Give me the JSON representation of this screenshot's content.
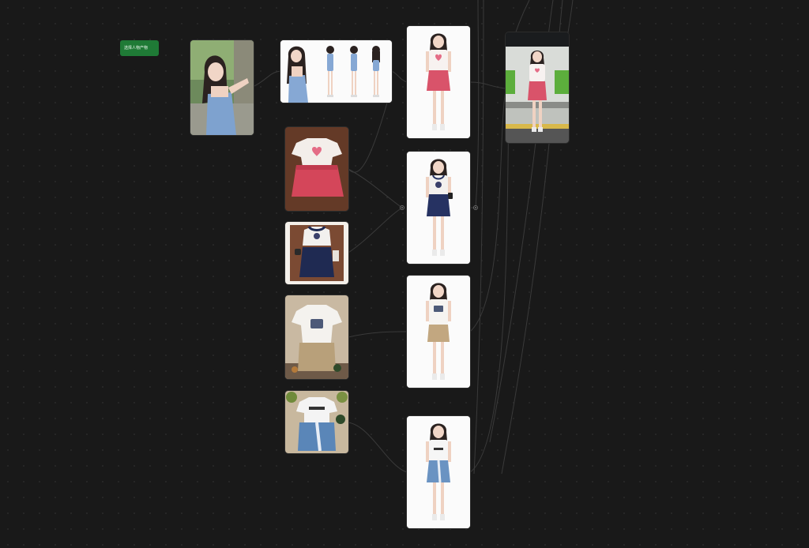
{
  "canvas": {
    "background": "#191919",
    "start_node_label": "选择人物产物",
    "start_node_color": "#1f7a36",
    "nodes": [
      {
        "id": "reference-photo",
        "kind": "image",
        "content": "girl-in-blue-tank-dress-outdoor"
      },
      {
        "id": "pose-sheet",
        "kind": "image",
        "content": "four-pose-reference-sheet"
      },
      {
        "id": "garment-1",
        "kind": "image",
        "content": "white-heart-tee-pink-skirt",
        "top_color": "#f3eeea",
        "bottom_color": "#d4465a"
      },
      {
        "id": "garment-2",
        "kind": "image",
        "content": "white-navy-trim-tee-navy-skirt",
        "top_color": "#f2f0ee",
        "bottom_color": "#1f2a52"
      },
      {
        "id": "garment-3",
        "kind": "image",
        "content": "white-print-tee-khaki-skirt",
        "top_color": "#f4f2ee",
        "bottom_color": "#b8a07a"
      },
      {
        "id": "garment-4",
        "kind": "image",
        "content": "white-tee-denim-skirt",
        "top_color": "#f4f4f4",
        "bottom_color": "#5a86b8"
      },
      {
        "id": "model-1",
        "kind": "image",
        "content": "model-pink-skirt",
        "top_color": "#f7f2f0",
        "bottom_color": "#d9536a"
      },
      {
        "id": "model-2",
        "kind": "image",
        "content": "model-navy-skirt",
        "top_color": "#f3f1ef",
        "bottom_color": "#263262"
      },
      {
        "id": "model-3",
        "kind": "image",
        "content": "model-khaki-skirt",
        "top_color": "#f6f4f1",
        "bottom_color": "#c2a780"
      },
      {
        "id": "model-4",
        "kind": "image",
        "content": "model-denim-skirt",
        "top_color": "#f6f6f6",
        "bottom_color": "#6a93c2"
      },
      {
        "id": "output-scene",
        "kind": "image",
        "content": "model-at-train-station",
        "top_color": "#f7f2f0",
        "bottom_color": "#d9536a"
      }
    ]
  }
}
